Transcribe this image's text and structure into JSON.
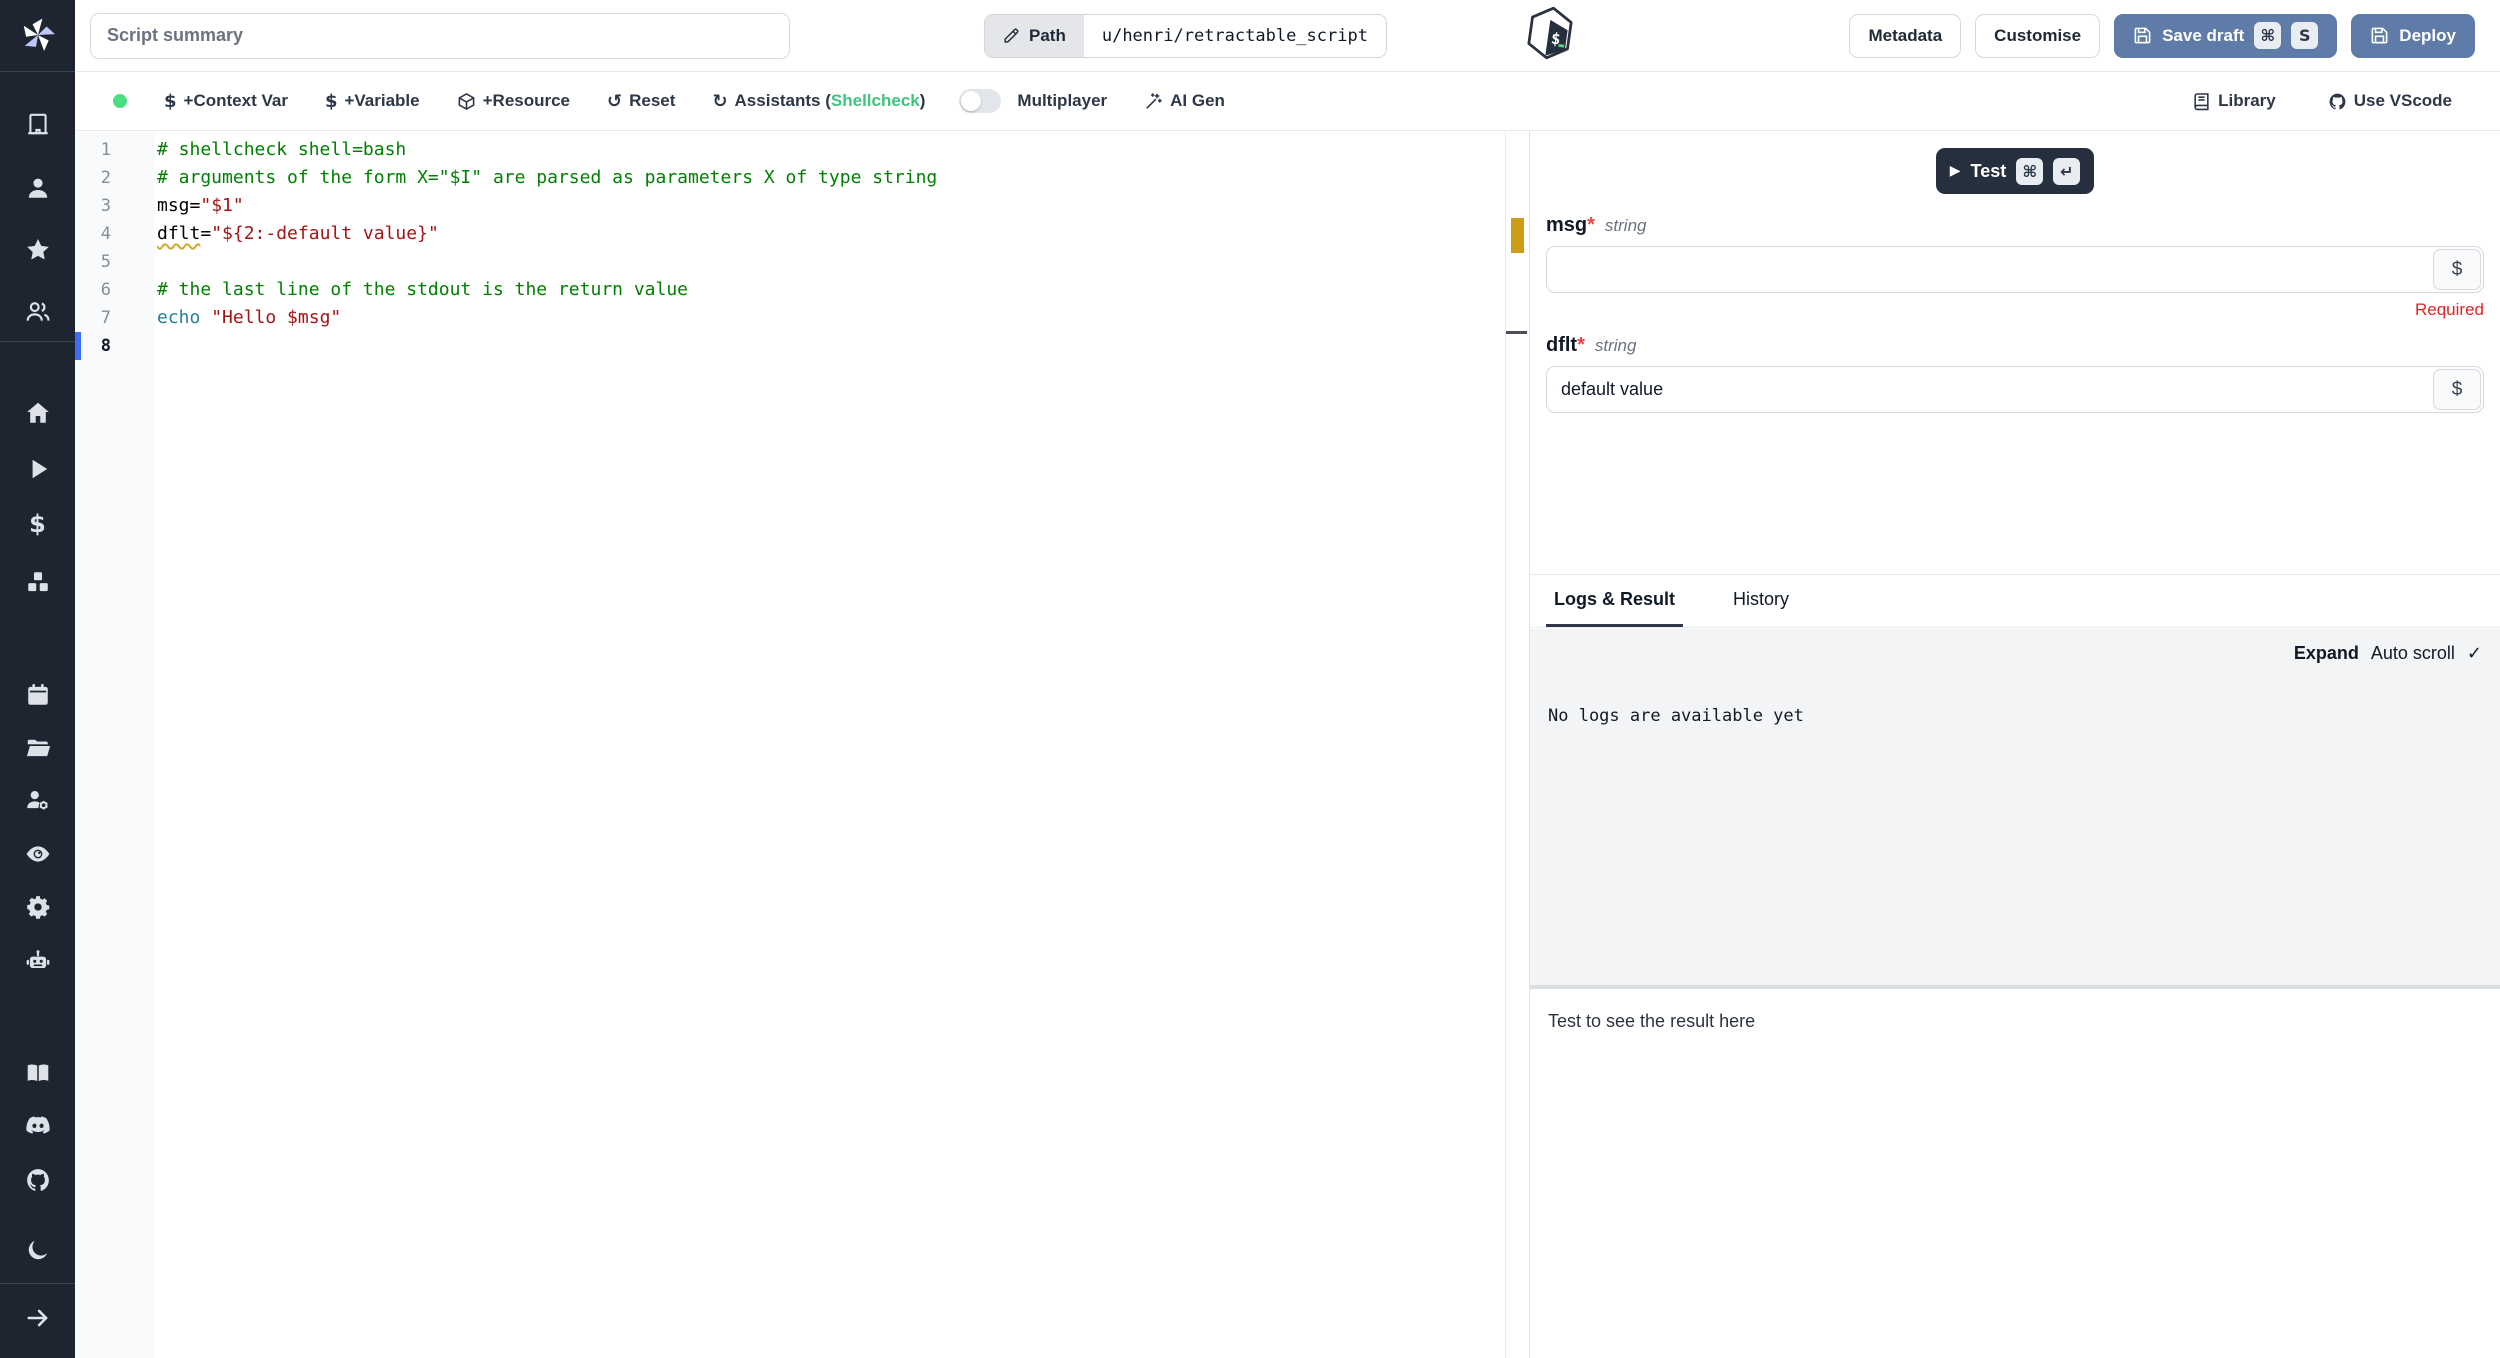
{
  "topbar": {
    "summary_placeholder": "Script summary",
    "path_label": "Path",
    "path_value": "u/henri/retractable_script",
    "metadata": "Metadata",
    "customise": "Customise",
    "save_draft": "Save draft",
    "deploy": "Deploy",
    "save_kbd_mod": "⌘",
    "save_kbd_key": "S"
  },
  "toolbar": {
    "context_var": "+Context Var",
    "variable": "+Variable",
    "resource": "+Resource",
    "reset": "Reset",
    "assistants_prefix": "Assistants (",
    "assistants_name": "Shellcheck",
    "assistants_suffix": ")",
    "multiplayer": "Multiplayer",
    "ai_gen": "AI Gen",
    "library": "Library",
    "use_vscode": "Use VScode",
    "dollar_glyph": "$",
    "reset_glyph": "↺",
    "assistants_glyph": "↻"
  },
  "editor": {
    "lines": [
      {
        "n": "1",
        "parts": [
          [
            "cmt",
            "# shellcheck shell=bash"
          ]
        ]
      },
      {
        "n": "2",
        "parts": [
          [
            "cmt",
            "# arguments of the form X=\"$I\" are parsed as parameters X of type string"
          ]
        ]
      },
      {
        "n": "3",
        "parts": [
          [
            "pln",
            "msg="
          ],
          [
            "str",
            "\"$1\""
          ]
        ]
      },
      {
        "n": "4",
        "parts": [
          [
            "pln warn",
            "dflt"
          ],
          [
            "pln",
            "="
          ],
          [
            "str",
            "\"${2:-default value}\""
          ]
        ]
      },
      {
        "n": "5",
        "parts": []
      },
      {
        "n": "6",
        "parts": [
          [
            "cmt",
            "# the last line of the stdout is the return value"
          ]
        ]
      },
      {
        "n": "7",
        "parts": [
          [
            "cmd",
            "echo"
          ],
          [
            "pln",
            " "
          ],
          [
            "str",
            "\"Hello $msg\""
          ]
        ]
      },
      {
        "n": "8",
        "parts": [],
        "active": true
      }
    ]
  },
  "right_panel": {
    "test_label": "Test",
    "test_play_glyph": "▶",
    "test_kbd_mod": "⌘",
    "test_kbd_enter": "↵",
    "fields": [
      {
        "name": "msg",
        "star": "*",
        "type": "string",
        "value": "",
        "dollar": "$",
        "error": "Required"
      },
      {
        "name": "dflt",
        "star": "*",
        "type": "string",
        "value": "default value",
        "dollar": "$"
      }
    ],
    "tabs": {
      "logs_result": "Logs & Result",
      "history": "History"
    },
    "logs": {
      "expand": "Expand",
      "autoscroll": "Auto scroll",
      "check": "✓",
      "empty": "No logs are available yet"
    },
    "result_placeholder": "Test to see the result here"
  },
  "colors": {
    "sidebar_bg": "#1e2530",
    "primary_button": "#5e7ca7",
    "dark_button": "#262f3d",
    "status_dot": "#4ade80",
    "shellcheck_green": "#3fc380",
    "comment_green": "#008000",
    "string_red": "#a31515",
    "command_teal": "#267f99",
    "warn_squiggle": "#d4a72c",
    "required_red": "#dc2626"
  }
}
